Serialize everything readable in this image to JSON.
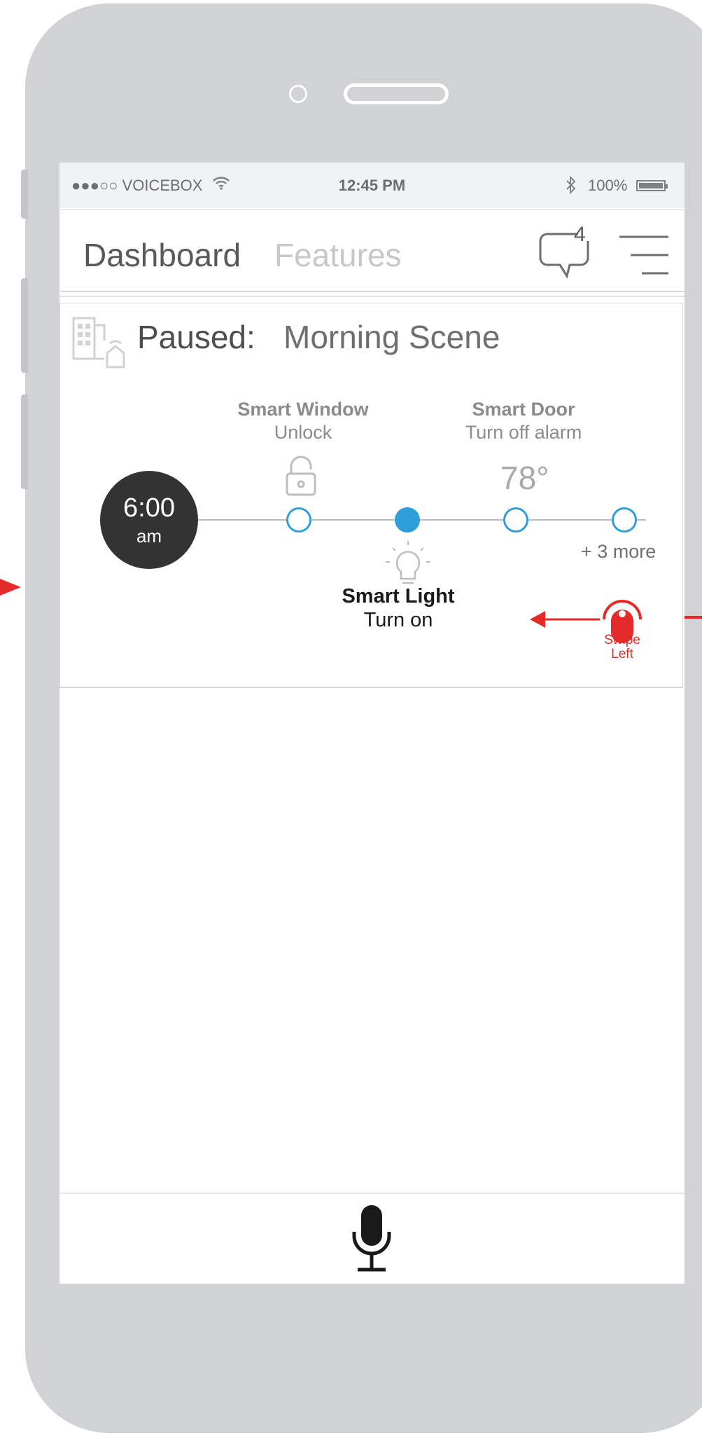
{
  "status_bar": {
    "carrier": "●●●○○ VOICEBOX",
    "time": "12:45 PM",
    "battery": "100%",
    "wifi_icon": "wifi-icon",
    "bluetooth_icon": "bluetooth-icon"
  },
  "nav": {
    "tabs": [
      {
        "label": "Dashboard",
        "active": true
      },
      {
        "label": "Features",
        "active": false
      }
    ],
    "chat_count": "4"
  },
  "scene": {
    "status": "Paused:",
    "name": "Morning Scene",
    "start_time": {
      "time": "6:00",
      "period": "am"
    },
    "devices": [
      {
        "name": "Smart Window",
        "action": "Unlock",
        "icon": "lock-icon"
      },
      {
        "name": "Smart Light",
        "action": "Turn on",
        "icon": "light-bulb-icon",
        "active": true
      },
      {
        "name": "Smart Door",
        "action": "Turn off alarm",
        "value": "78°"
      }
    ],
    "more": "+ 3 more"
  },
  "hint": {
    "label_line1": "Swipe",
    "label_line2": "Left",
    "color": "#e52a2a"
  },
  "colors": {
    "accent": "#2f9fd9",
    "phone_body": "#d1d2d4",
    "hint": "#e52a2a"
  }
}
